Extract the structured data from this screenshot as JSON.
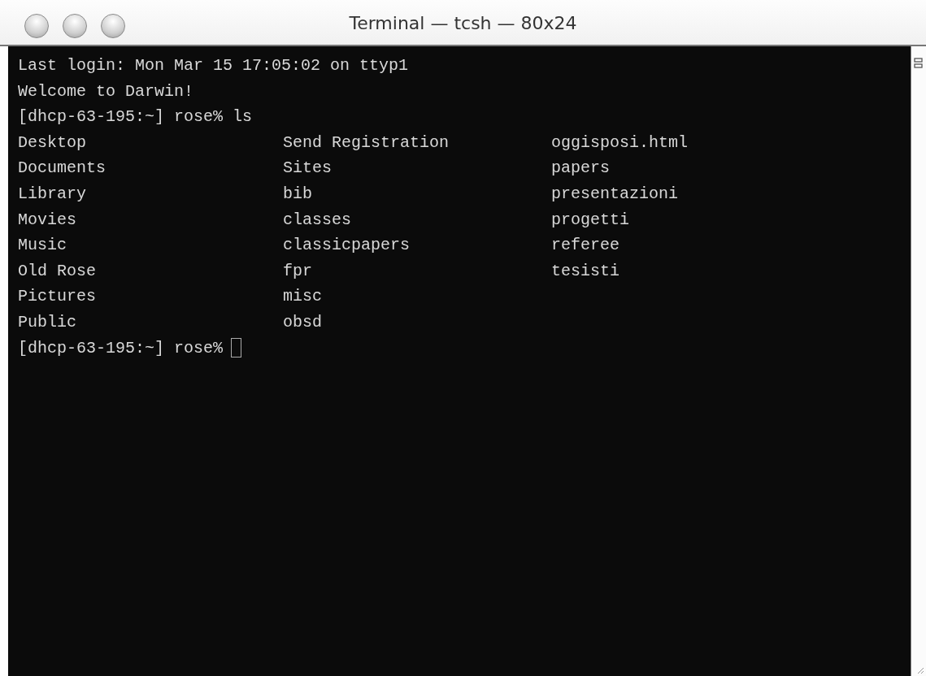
{
  "window": {
    "title": "Terminal — tcsh — 80x24"
  },
  "terminal": {
    "lines": [
      {
        "kind": "text",
        "text": "Last login: Mon Mar 15 17:05:02 on ttyp1"
      },
      {
        "kind": "text",
        "text": "Welcome to Darwin!"
      },
      {
        "kind": "text",
        "text": "[dhcp-63-195:~] rose% ls"
      },
      {
        "kind": "columns",
        "cells": [
          "Desktop",
          "Send Registration",
          "oggisposi.html"
        ]
      },
      {
        "kind": "columns",
        "cells": [
          "Documents",
          "Sites",
          "papers"
        ]
      },
      {
        "kind": "columns",
        "cells": [
          "Library",
          "bib",
          "presentazioni"
        ]
      },
      {
        "kind": "columns",
        "cells": [
          "Movies",
          "classes",
          "progetti"
        ]
      },
      {
        "kind": "columns",
        "cells": [
          "Music",
          "classicpapers",
          "referee"
        ]
      },
      {
        "kind": "columns",
        "cells": [
          "Old Rose",
          "fpr",
          "tesisti"
        ]
      },
      {
        "kind": "columns",
        "cells": [
          "Pictures",
          "misc"
        ]
      },
      {
        "kind": "columns",
        "cells": [
          "Public",
          "obsd"
        ]
      },
      {
        "kind": "prompt",
        "text": "[dhcp-63-195:~] rose%"
      }
    ]
  }
}
